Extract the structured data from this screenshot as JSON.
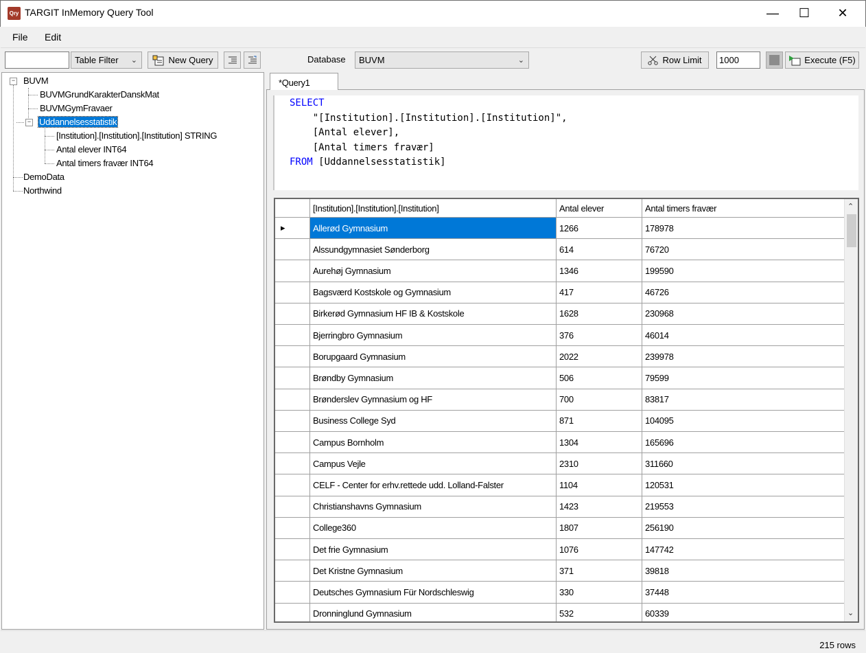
{
  "window": {
    "icon_text": "Qry",
    "title": "TARGIT InMemory Query Tool",
    "minimize": "—",
    "maximize": "☐",
    "close": "✕"
  },
  "menu": {
    "file": "File",
    "edit": "Edit"
  },
  "toolbar": {
    "filter_value": "",
    "table_filter": "Table Filter",
    "new_query": "New Query",
    "database_label": "Database",
    "database_value": "BUVM",
    "row_limit": "Row Limit",
    "row_limit_value": "1000",
    "execute": "Execute (F5)"
  },
  "tree": {
    "root": "BUVM",
    "tables": [
      "BUVMGrundKarakterDanskMat",
      "BUVMGymFravaer",
      "Uddannelsesstatistik"
    ],
    "columns": [
      "[Institution].[Institution].[Institution] STRING",
      "Antal elever INT64",
      "Antal timers fravær INT64"
    ],
    "other_dbs": [
      "DemoData",
      "Northwind"
    ]
  },
  "tab": {
    "label": "*Query1"
  },
  "query": {
    "kw_select": "SELECT",
    "line1": "    \"[Institution].[Institution].[Institution]\",",
    "line2": "    [Antal elever],",
    "line3": "    [Antal timers fravær]",
    "kw_from": "FROM",
    "from_rest": " [Uddannelsesstatistik]"
  },
  "grid": {
    "headers": [
      "[Institution].[Institution].[Institution]",
      "Antal elever",
      "Antal timers fravær"
    ],
    "rows": [
      [
        "Allerød Gymnasium",
        "1266",
        "178978"
      ],
      [
        "Alssundgymnasiet Sønderborg",
        "614",
        "76720"
      ],
      [
        "Aurehøj Gymnasium",
        "1346",
        "199590"
      ],
      [
        "Bagsværd Kostskole og Gymnasium",
        "417",
        "46726"
      ],
      [
        "Birkerød Gymnasium HF IB & Kostskole",
        "1628",
        "230968"
      ],
      [
        "Bjerringbro Gymnasium",
        "376",
        "46014"
      ],
      [
        "Borupgaard Gymnasium",
        "2022",
        "239978"
      ],
      [
        "Brøndby Gymnasium",
        "506",
        "79599"
      ],
      [
        "Brønderslev Gymnasium og HF",
        "700",
        "83817"
      ],
      [
        "Business College Syd",
        "871",
        "104095"
      ],
      [
        "Campus Bornholm",
        "1304",
        "165696"
      ],
      [
        "Campus Vejle",
        "2310",
        "311660"
      ],
      [
        "CELF - Center for erhv.rettede udd. Lolland-Falster",
        "1104",
        "120531"
      ],
      [
        "Christianshavns Gymnasium",
        "1423",
        "219553"
      ],
      [
        "College360",
        "1807",
        "256190"
      ],
      [
        "Det frie Gymnasium",
        "1076",
        "147742"
      ],
      [
        "Det Kristne Gymnasium",
        "371",
        "39818"
      ],
      [
        "Deutsches Gymnasium Für Nordschleswig",
        "330",
        "37448"
      ],
      [
        "Dronninglund Gymnasium",
        "532",
        "60339"
      ]
    ]
  },
  "status": {
    "rows": "215 rows"
  }
}
